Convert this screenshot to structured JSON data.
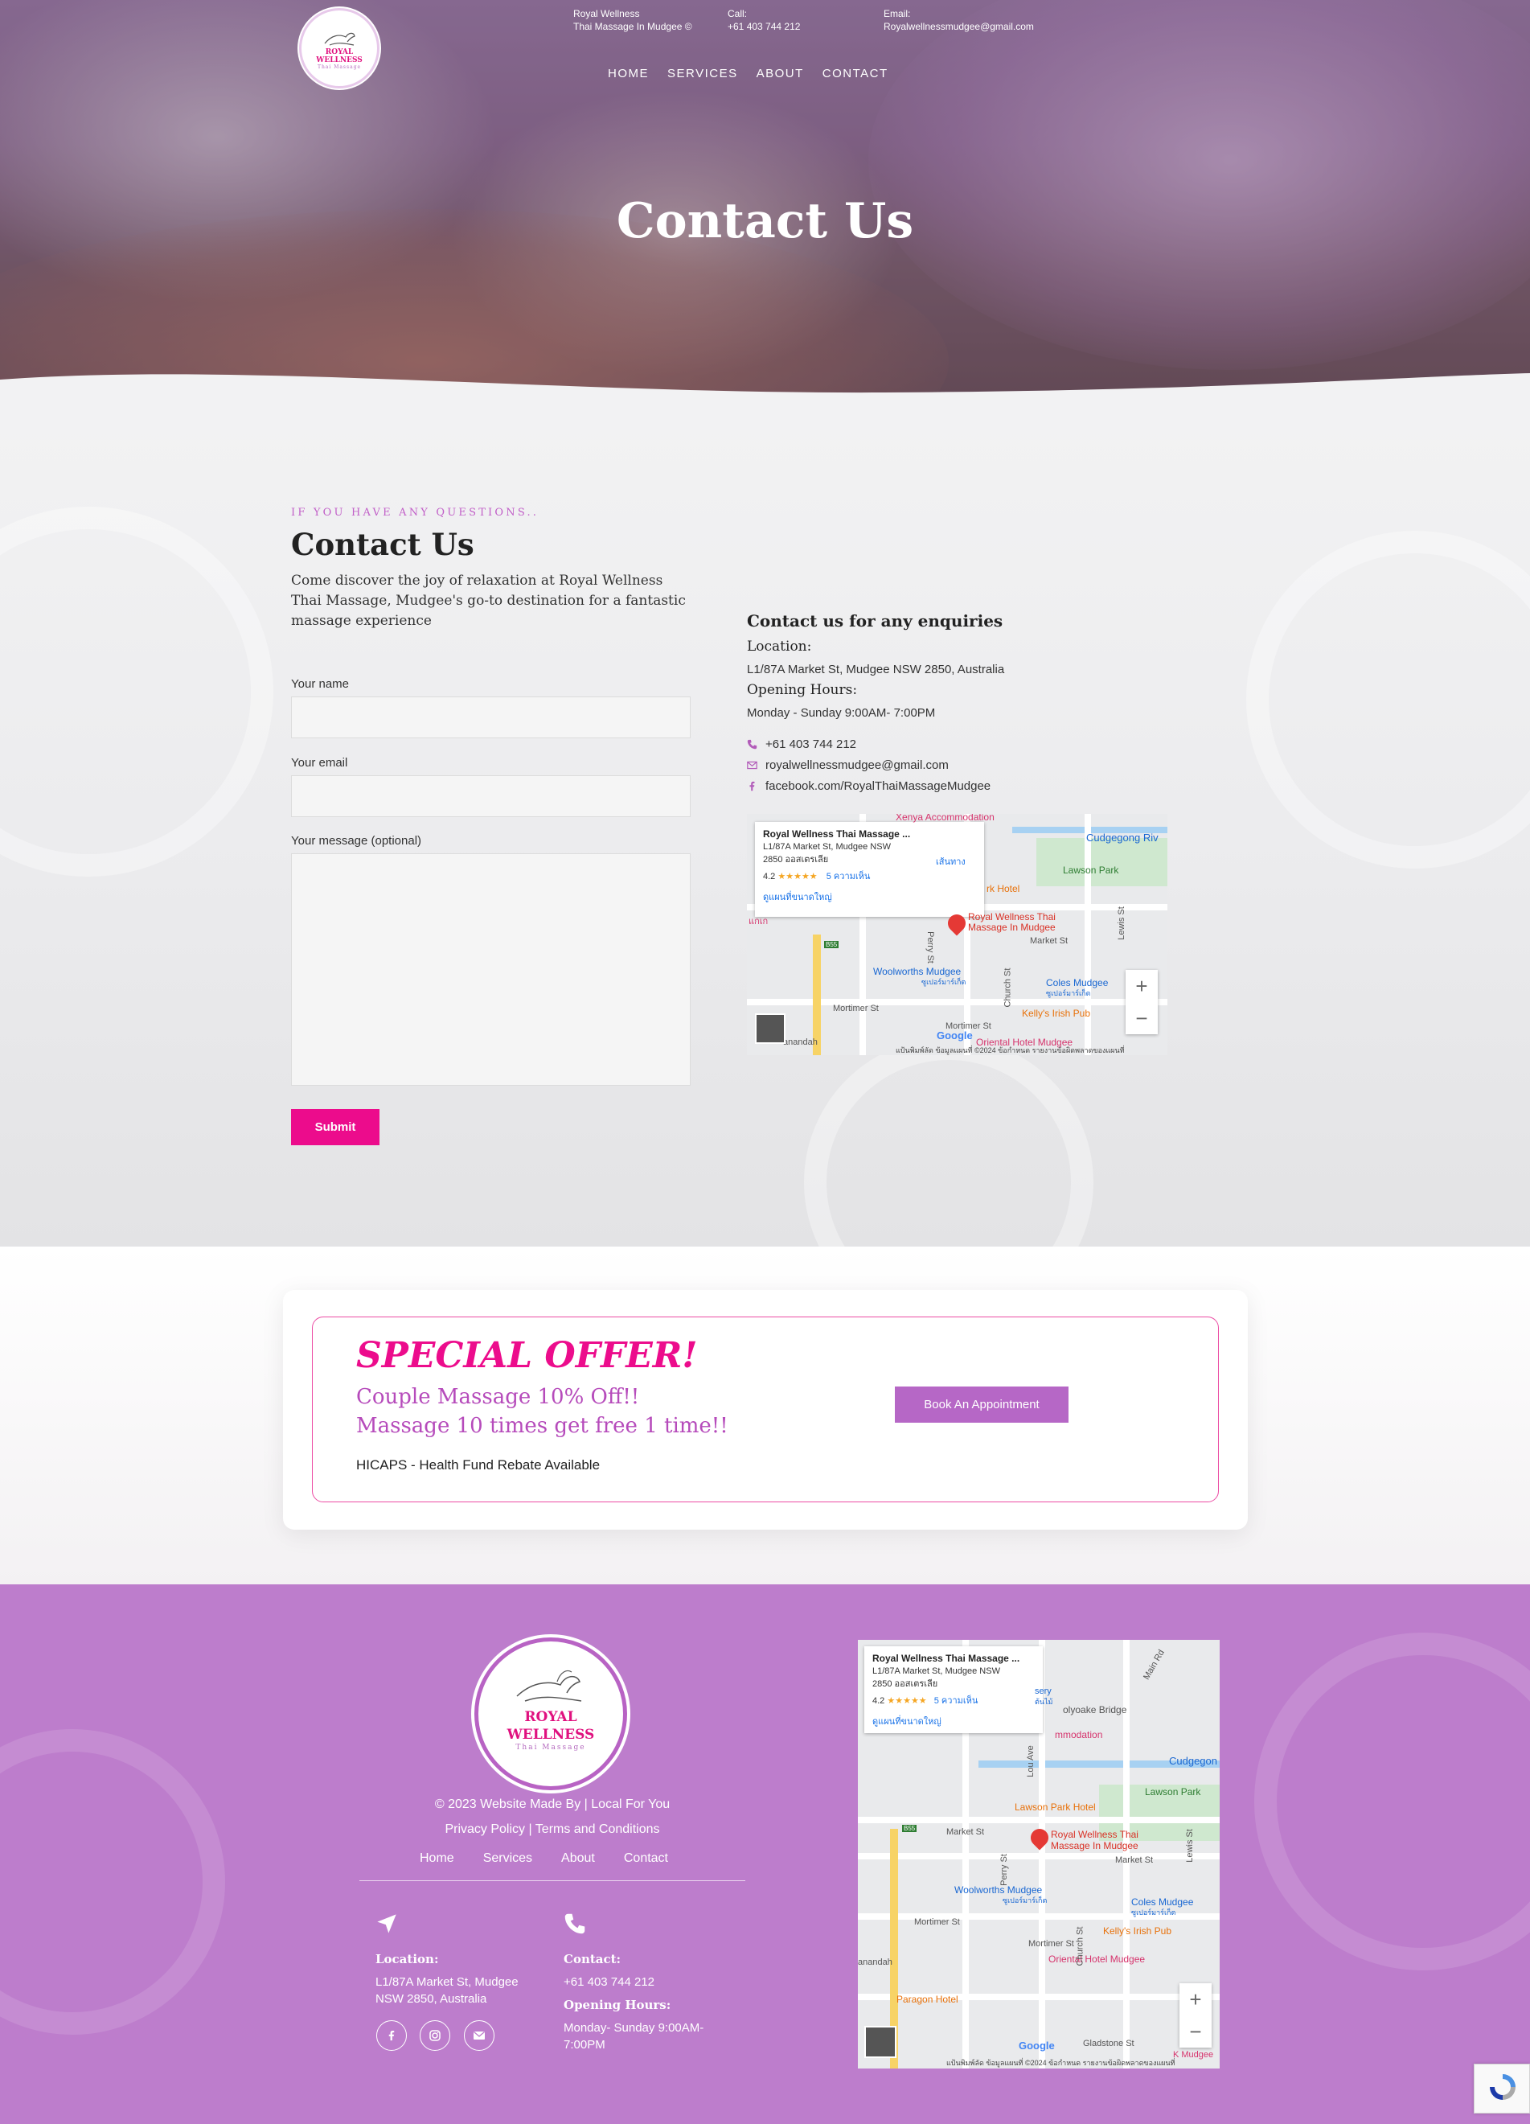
{
  "header": {
    "logo": {
      "line1": "ROYAL",
      "line2": "WELLNESS",
      "line3": "Thai Massage"
    },
    "business": {
      "line1": "Royal Wellness",
      "line2": "Thai Massage In Mudgee ©"
    },
    "call": {
      "label": "Call:",
      "value": "+61 403 744 212"
    },
    "email": {
      "label": "Email:",
      "value": "Royalwellnessmudgee@gmail.com"
    },
    "nav": [
      "HOME",
      "SERVICES",
      "ABOUT",
      "CONTACT"
    ]
  },
  "hero": {
    "title": "Contact Us"
  },
  "contact": {
    "eyebrow": "IF YOU HAVE ANY QUESTIONS..",
    "heading": "Contact Us",
    "intro": "Come discover the joy of relaxation at Royal Wellness Thai Massage, Mudgee's go-to destination for a fantastic massage experience",
    "form": {
      "name_label": "Your name",
      "email_label": "Your email",
      "message_label": "Your message (optional)",
      "submit_label": "Submit"
    },
    "enquiries": {
      "heading": "Contact us for any enquiries",
      "location_label": "Location:",
      "location_value": "L1/87A Market St, Mudgee NSW 2850, Australia",
      "hours_label": "Opening Hours:",
      "hours_value": "Monday - Sunday 9:00AM- 7:00PM",
      "phone": "+61 403 744 212",
      "email": "royalwellnessmudgee@gmail.com",
      "facebook": "facebook.com/RoyalThaiMassageMudgee"
    },
    "map": {
      "card_title": "Royal Wellness Thai Massage ...",
      "card_addr1": "L1/87A Market St, Mudgee NSW",
      "card_addr2": "2850 ออสเตรเลีย",
      "rating": "4.2",
      "stars": "★★★★★",
      "reviews": "5 ความเห็น",
      "directions": "เส้นทาง",
      "larger": "ดูแผนที่ขนาดใหญ่",
      "pin_label1": "Royal Wellness Thai",
      "pin_label2": "Massage In Mudgee",
      "poi": [
        "Xenya Accommodation",
        "Cudgegong Riv",
        "Lawson Park",
        "rk Hotel",
        "Woolworths Mudgee",
        "ซูเปอร์มาร์เก็ต",
        "Coles Mudgee",
        "ซูเปอร์มาร์เก็ต",
        "Kelly's Irish Pub",
        "Oriental Hotel Mudgee",
        "Mortimer St",
        "Market St",
        "Perry St",
        "Church St",
        "Lewis St",
        "Mortimer St",
        "anandah",
        "B55",
        "แกเก"
      ],
      "google": "Google",
      "footer": "แป้นพิมพ์ลัด   ข้อมูลแผนที่ ©2024   ข้อกำหนด   รายงานข้อผิดพลาดของแผนที่"
    }
  },
  "offer": {
    "title": "SPECIAL OFFER!",
    "line1": "Couple Massage 10% Off!!",
    "line2": "Massage 10 times get free 1 time!!",
    "hicaps": "HICAPS - Health Fund Rebate Available",
    "button": "Book An Appointment"
  },
  "footer": {
    "logo": {
      "line1": "ROYAL",
      "line2": "WELLNESS",
      "line3": "Thai Massage"
    },
    "copyright": "© 2023 Website Made By | Local For You",
    "policy": "Privacy Policy | Terms and Conditions",
    "nav": [
      "Home",
      "Services",
      "About",
      "Contact"
    ],
    "location_label": "Location:",
    "location_value": "L1/87A Market St, Mudgee NSW 2850, Australia",
    "contact_label": "Contact:",
    "contact_value": "+61 403 744 212",
    "hours_label": "Opening Hours:",
    "hours_value": "Monday- Sunday 9:00AM-7:00PM",
    "map": {
      "card_title": "Royal Wellness Thai Massage ...",
      "card_addr1": "L1/87A Market St, Mudgee NSW",
      "card_addr2": "2850 ออสเตรเลีย",
      "rating": "4.2",
      "stars": "★★★★★",
      "reviews": "5 ความเห็น",
      "larger": "ดูแผนที่ขนาดใหญ่",
      "pin_label1": "Royal Wellness Thai",
      "pin_label2": "Massage In Mudgee",
      "poi": [
        "Lawson Park Hotel",
        "Lawson Park",
        "Cudgegon",
        "olyoake Bridge",
        "mmodation",
        "Woolworths Mudgee",
        "ซูเปอร์มาร์เก็ต",
        "Coles Mudgee",
        "ซูเปอร์มาร์เก็ต",
        "Kelly's Irish Pub",
        "Oriental Hotel Mudgee",
        "Paragon Hotel",
        "Market St",
        "Mortimer St",
        "Mortimer St",
        "Market St",
        "Perry St",
        "Church St",
        "Lewis St",
        "Gladstone St",
        "Main Rd",
        "Lou Ave",
        "anandah",
        "B55",
        "sery",
        "ต้นไม้",
        "K Mudgee"
      ],
      "google": "Google",
      "footer": "แป้นพิมพ์ลัด   ข้อมูลแผนที่ ©2024   ข้อกำหนด   รายงานข้อผิดพลาดของแผนที่"
    }
  },
  "colors": {
    "pink": "#ec0c8c",
    "purple": "#b667c6",
    "footer_bg": "#bd7dcc"
  }
}
